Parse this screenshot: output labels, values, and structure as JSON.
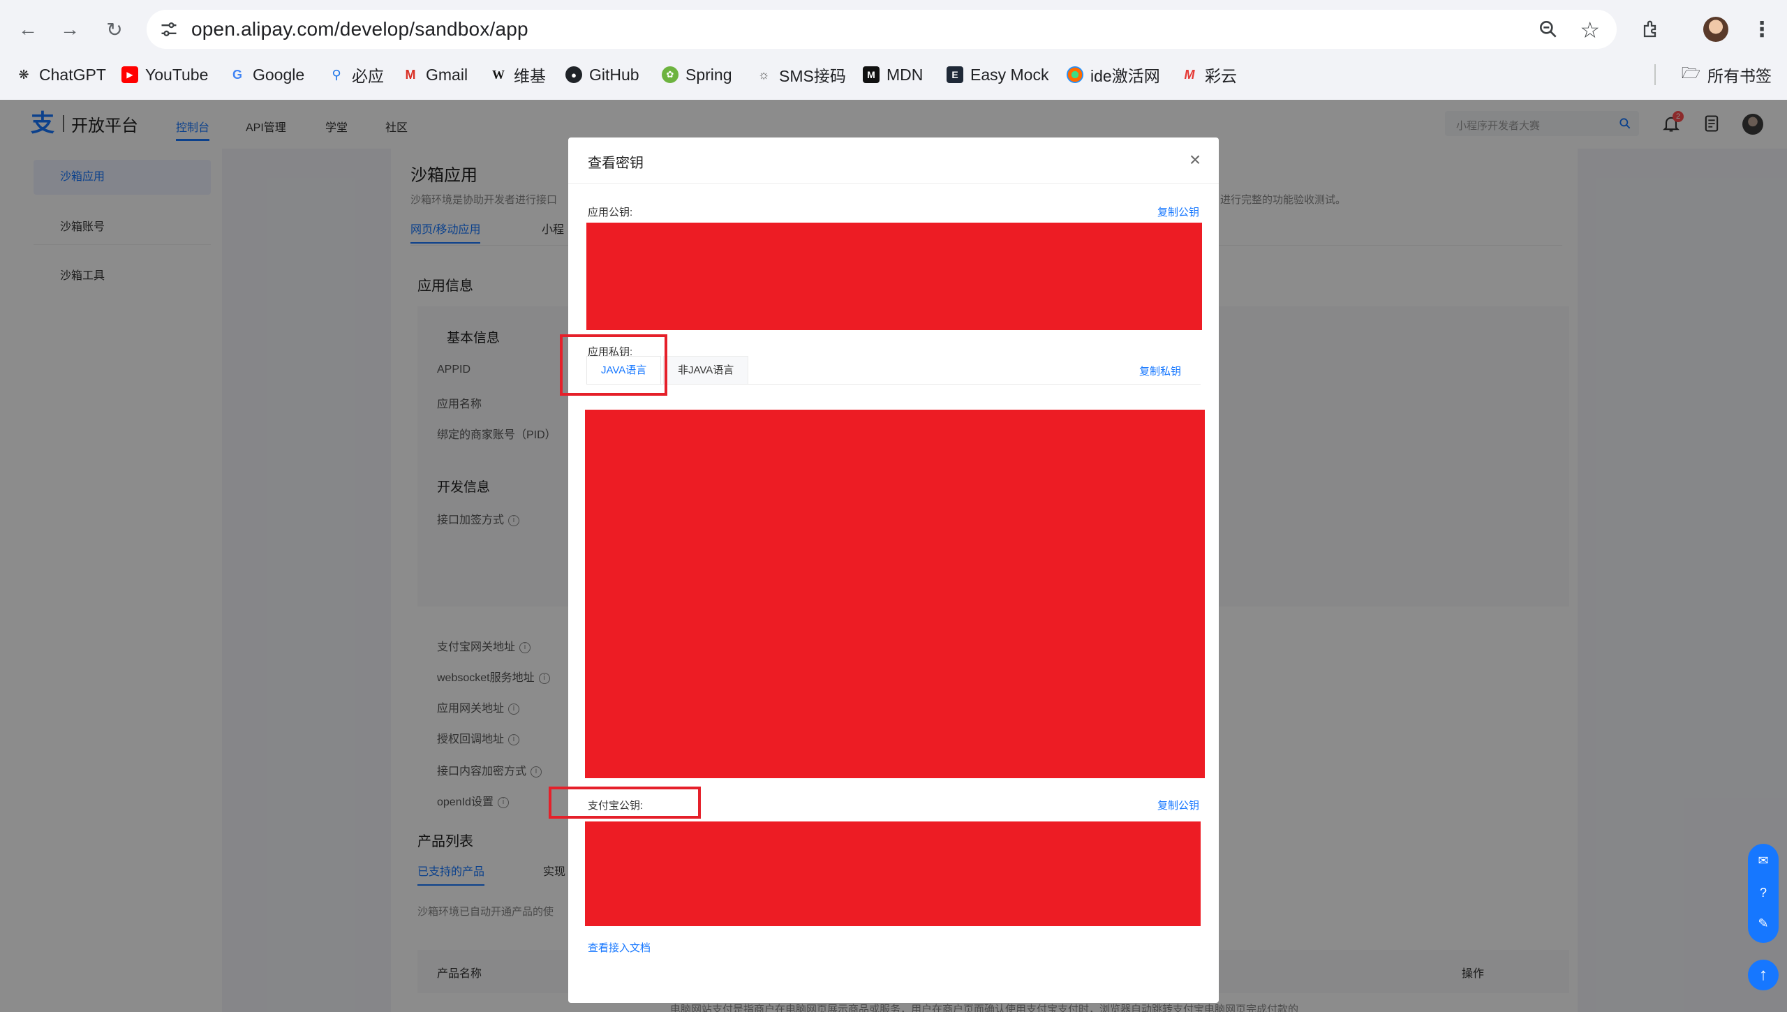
{
  "browser": {
    "url": "open.alipay.com/develop/sandbox/app",
    "bookmarks": [
      {
        "label": "ChatGPT",
        "icon": "chatgpt-icon"
      },
      {
        "label": "YouTube",
        "icon": "youtube-icon"
      },
      {
        "label": "Google",
        "icon": "google-icon"
      },
      {
        "label": "必应",
        "icon": "bing-icon"
      },
      {
        "label": "Gmail",
        "icon": "gmail-icon"
      },
      {
        "label": "维基",
        "icon": "wikipedia-icon"
      },
      {
        "label": "GitHub",
        "icon": "github-icon"
      },
      {
        "label": "Spring",
        "icon": "spring-icon"
      },
      {
        "label": "SMS接码",
        "icon": "sms-icon"
      },
      {
        "label": "MDN",
        "icon": "mdn-icon"
      },
      {
        "label": "Easy Mock",
        "icon": "easymock-icon"
      },
      {
        "label": "ide激活网",
        "icon": "ide-icon"
      },
      {
        "label": "彩云",
        "icon": "caiyun-icon"
      }
    ],
    "all_bookmarks": "所有书签"
  },
  "site": {
    "logo_text": "开放平台",
    "nav": [
      "控制台",
      "API管理",
      "学堂",
      "社区"
    ],
    "search_placeholder": "小程序开发者大赛",
    "notification_count": "2"
  },
  "sidebar": {
    "items": [
      "沙箱应用",
      "沙箱账号",
      "沙箱工具"
    ]
  },
  "content": {
    "title": "沙箱应用",
    "desc_left": "沙箱环境是协助开发者进行接口",
    "desc_right": "进行完整的功能验收测试。",
    "tabs": [
      "网页/移动应用",
      "小程"
    ],
    "app_info": "应用信息",
    "basic_info": "基本信息",
    "fields_basic": [
      "APPID",
      "应用名称",
      "绑定的商家账号（PID）"
    ],
    "dev_info": "开发信息",
    "fields_dev": [
      "接口加签方式",
      "支付宝网关地址",
      "websocket服务地址",
      "应用网关地址",
      "授权回调地址",
      "接口内容加密方式",
      "openId设置"
    ],
    "product_list": "产品列表",
    "product_tabs": [
      "已支持的产品",
      "实现"
    ],
    "product_desc": "沙箱环境已自动开通产品的使",
    "table_headers": [
      "产品名称",
      "操作"
    ],
    "footer_text": "电脑网站支付是指商户在电脑网页展示商品或服务，用户在商户页面确认使用支付宝支付时，浏览器自动跳转支付宝电脑网页完成付款的"
  },
  "modal": {
    "title": "查看密钥",
    "app_public_key_label": "应用公钥:",
    "copy_public_key": "复制公钥",
    "app_private_key_label": "应用私钥:",
    "key_tabs": [
      "JAVA语言",
      "非JAVA语言"
    ],
    "copy_private_key": "复制私钥",
    "alipay_public_key_label": "支付宝公钥:",
    "copy_alipay_public_key": "复制公钥",
    "doc_link": "查看接入文档"
  },
  "colors": {
    "accent": "#1677ff",
    "redaction": "#ed1c24",
    "annotation": "#e5202a"
  }
}
